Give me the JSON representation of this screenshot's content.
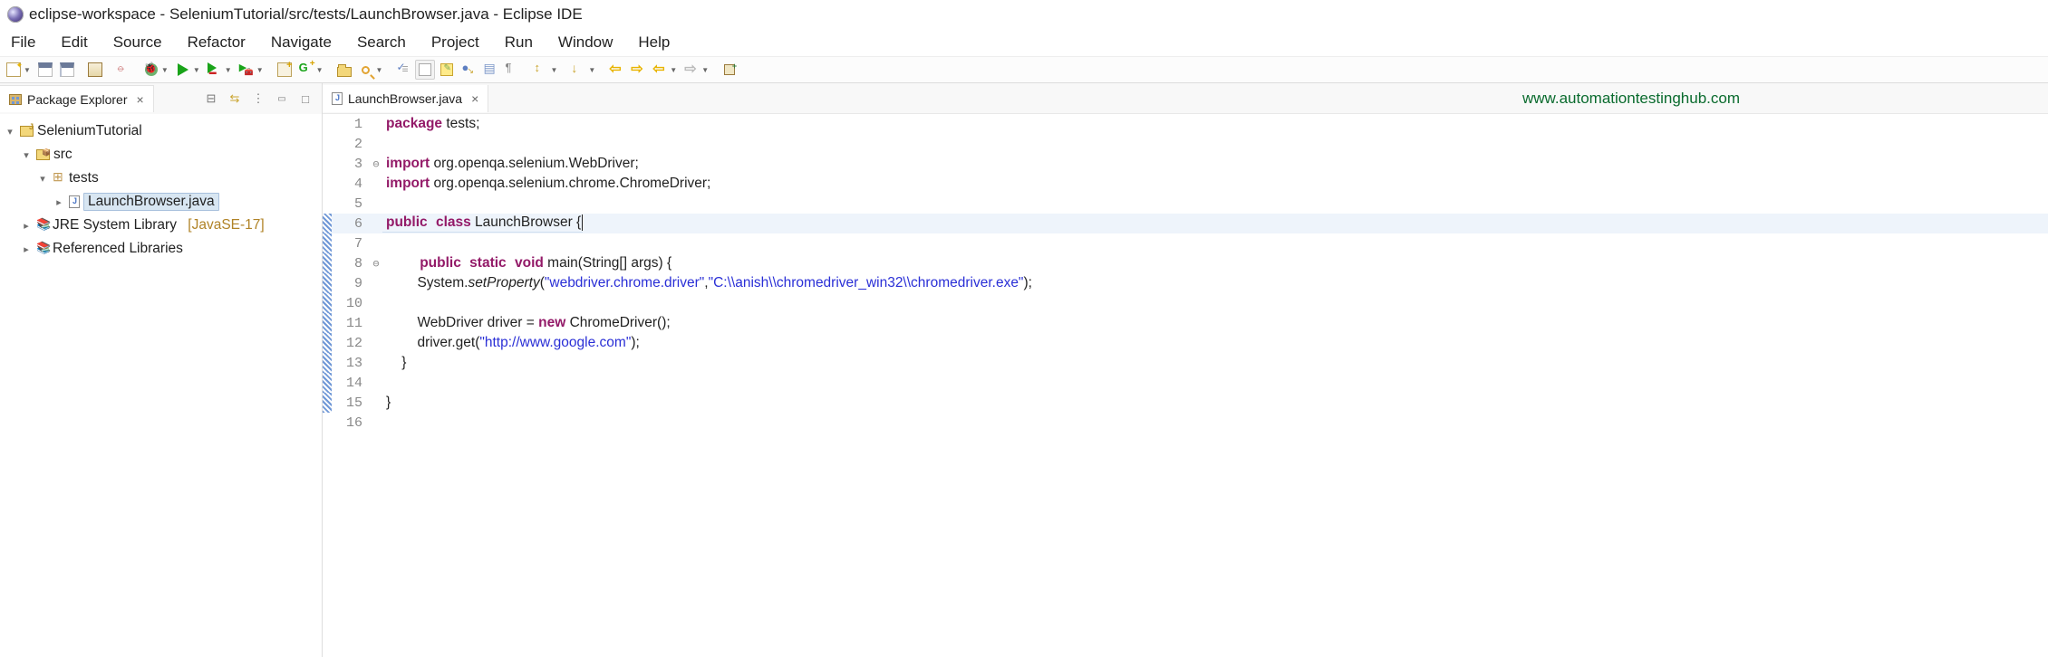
{
  "title": "eclipse-workspace - SeleniumTutorial/src/tests/LaunchBrowser.java - Eclipse IDE",
  "menu": [
    "File",
    "Edit",
    "Source",
    "Refactor",
    "Navigate",
    "Search",
    "Project",
    "Run",
    "Window",
    "Help"
  ],
  "packageExplorer": {
    "title": "Package Explorer",
    "project": "SeleniumTutorial",
    "srcFolder": "src",
    "pkg": "tests",
    "file": "LaunchBrowser.java",
    "jre": "JRE System Library",
    "jreVer": "[JavaSE-17]",
    "refLibs": "Referenced Libraries"
  },
  "editor": {
    "tab": "LaunchBrowser.java",
    "watermark": "www.automationtestinghub.com",
    "lines": {
      "l1a": "package",
      "l1b": " tests;",
      "l3a": "import",
      "l3b": " org.openqa.selenium.WebDriver;",
      "l4a": "import",
      "l4b": " org.openqa.selenium.chrome.ChromeDriver;",
      "l6a": "public",
      "l6b": "class",
      "l6c": " LaunchBrowser {",
      "l8a": "public",
      "l8b": "static",
      "l8c": "void",
      "l8d": " main(String[] args) {",
      "l9a": "        System.",
      "l9b": "setProperty",
      "l9c": "(",
      "l9d": "\"webdriver.chrome.driver\"",
      "l9e": ",",
      "l9f": "\"C:\\\\anish\\\\chromedriver_win32\\\\chromedriver.exe\"",
      "l9g": ");",
      "l11a": "        WebDriver driver = ",
      "l11b": "new",
      "l11c": " ChromeDriver();",
      "l12a": "        driver.get(",
      "l12b": "\"http://www.google.com\"",
      "l12c": ");",
      "l13": "    }",
      "l15": "}"
    }
  }
}
